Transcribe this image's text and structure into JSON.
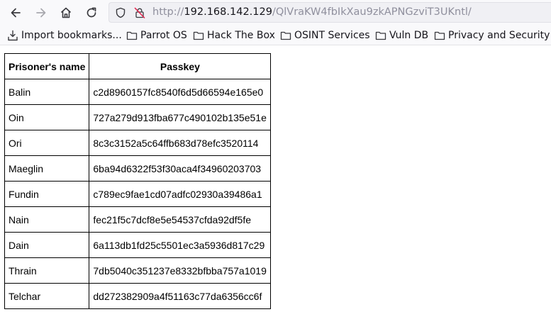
{
  "browser": {
    "url": {
      "scheme": "http://",
      "host": "192.168.142.129",
      "path": "/QlVraKW4fbIkXau9zkAPNGzviT3UKntl/"
    },
    "icons": [
      "back-icon",
      "forward-icon",
      "home-icon",
      "reload-icon",
      "shield-icon",
      "insecure-lock-icon"
    ]
  },
  "bookmarks": [
    {
      "label": "Import bookmarks...",
      "icon": "import-icon"
    },
    {
      "label": "Parrot OS",
      "icon": "folder-icon"
    },
    {
      "label": "Hack The Box",
      "icon": "folder-icon"
    },
    {
      "label": "OSINT Services",
      "icon": "folder-icon"
    },
    {
      "label": "Vuln DB",
      "icon": "folder-icon"
    },
    {
      "label": "Privacy and Security",
      "icon": "folder-icon"
    }
  ],
  "table": {
    "headers": [
      "Prisoner's name",
      "Passkey"
    ],
    "rows": [
      [
        "Balin",
        "c2d8960157fc8540f6d5d66594e165e0"
      ],
      [
        "Oin",
        "727a279d913fba677c490102b135e51e"
      ],
      [
        "Ori",
        "8c3c3152a5c64ffb683d78efc3520114"
      ],
      [
        "Maeglin",
        "6ba94d6322f53f30aca4f34960203703"
      ],
      [
        "Fundin",
        "c789ec9fae1cd07adfc02930a39486a1"
      ],
      [
        "Nain",
        "fec21f5c7dcf8e5e54537cfda92df5fe"
      ],
      [
        "Dain",
        "6a113db1fd25c5501ec3a5936d817c29"
      ],
      [
        "Thrain",
        "7db5040c351237e8332bfbba757a1019"
      ],
      [
        "Telchar",
        "dd272382909a4f51163c77da6356cc6f"
      ]
    ]
  }
}
